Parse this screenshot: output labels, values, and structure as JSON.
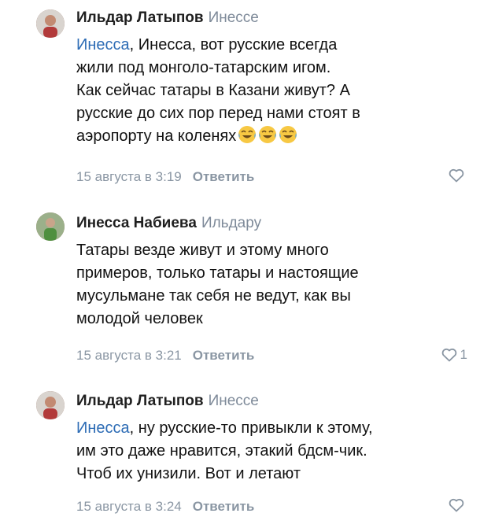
{
  "comments": [
    {
      "author": "Ильдар Латыпов",
      "reply_to": "Инессе",
      "mention": "Инесса",
      "text": ", Инесса, вот русские всегда\nжили под монголо-татарским игом.\nКак сейчас татары в Казани живут? А\nрусские до сих пор перед нами стоят в\nаэропорту на коленях",
      "emoji": [
        "tears-of-joy-emoji",
        "tears-of-joy-emoji",
        "tears-of-joy-emoji"
      ],
      "date": "15 августа в 3:19",
      "reply_label": "Ответить",
      "likes": ""
    },
    {
      "author": "Инесса Набиева",
      "reply_to": "Ильдару",
      "text": "Татары везде живут и этому много\nпримеров, только татары и настоящие\nмусульмане так себя не ведут, как вы\nмолодой человек",
      "date": "15 августа в 3:21",
      "reply_label": "Ответить",
      "likes": "1"
    },
    {
      "author": "Ильдар Латыпов",
      "reply_to": "Инессе",
      "mention": "Инесса",
      "text": ", ну русские-то привыкли к этому,\nим это даже нравится, этакий бдсм-чик.\nЧтоб их унизили. Вот и летают",
      "date": "15 августа в 3:24",
      "reply_label": "Ответить",
      "likes": ""
    }
  ],
  "colors": {
    "link": "#2d6cb5",
    "muted": "#8a96a3",
    "reply_to": "#7e8a99"
  },
  "icons": {
    "like": "heart-outline-icon",
    "emoji": "tears-of-joy-emoji"
  }
}
